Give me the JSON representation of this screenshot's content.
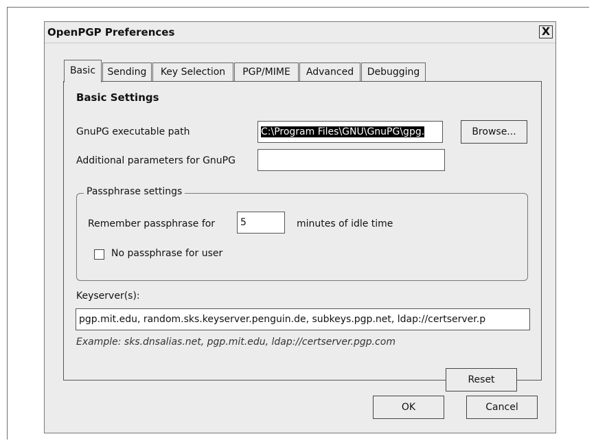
{
  "dialog": {
    "title": "OpenPGP Preferences",
    "close_label": "X"
  },
  "tabs": [
    {
      "label": "Basic",
      "active": true
    },
    {
      "label": "Sending",
      "active": false
    },
    {
      "label": "Key Selection",
      "active": false
    },
    {
      "label": "PGP/MIME",
      "active": false
    },
    {
      "label": "Advanced",
      "active": false
    },
    {
      "label": "Debugging",
      "active": false
    }
  ],
  "basic": {
    "heading": "Basic Settings",
    "gnupg_path_label": "GnuPG executable path",
    "gnupg_path_value": "C:\\Program Files\\GNU\\GnuPG\\gpg.",
    "browse_label": "Browse...",
    "additional_params_label": "Additional parameters for GnuPG",
    "additional_params_value": ""
  },
  "passphrase": {
    "group_title": "Passphrase settings",
    "remember_label": "Remember passphrase for",
    "remember_value": "5",
    "minutes_label": "minutes of idle time",
    "no_passphrase_label": "No passphrase for user",
    "no_passphrase_checked": false
  },
  "keyserver": {
    "label": "Keyserver(s):",
    "value": "pgp.mit.edu, random.sks.keyserver.penguin.de, subkeys.pgp.net, ldap://certserver.p",
    "example": "Example: sks.dnsalias.net, pgp.mit.edu, ldap://certserver.pgp.com"
  },
  "buttons": {
    "reset": "Reset",
    "ok": "OK",
    "cancel": "Cancel"
  }
}
